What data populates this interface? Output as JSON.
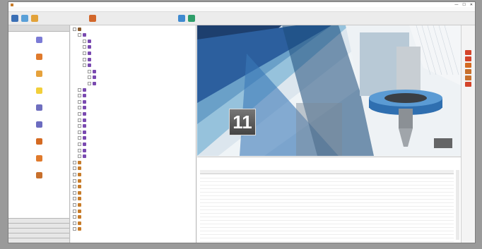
{
  "window": {
    "title": "",
    "controls": [
      "—",
      "☐",
      "✕"
    ]
  },
  "menu": [],
  "left_panel": {
    "header": "",
    "items": [
      {
        "label": "",
        "icon": "part-icon",
        "color": "#7b7bd6"
      },
      {
        "label": "",
        "icon": "machine-icon",
        "color": "#e07a2c"
      },
      {
        "label": "",
        "icon": "tool-icon",
        "color": "#e6a23c"
      },
      {
        "label": "",
        "icon": "smile-icon",
        "color": "#f2cf3a"
      },
      {
        "label": "",
        "icon": "fixture-icon",
        "color": "#6f6fbf"
      },
      {
        "label": "",
        "icon": "wrench-icon",
        "color": "#6c6cc0"
      },
      {
        "label": "",
        "icon": "gear-icon",
        "color": "#d46a22"
      },
      {
        "label": "",
        "icon": "cart-icon",
        "color": "#e07a2c"
      },
      {
        "label": "",
        "icon": "box-icon",
        "color": "#c8702c"
      }
    ],
    "bottom_buttons": [
      "",
      "",
      "",
      "",
      ""
    ]
  },
  "tree": {
    "nodes": [
      {
        "label": "",
        "depth": 0,
        "color": "#8a5a2c"
      },
      {
        "label": "",
        "depth": 1,
        "color": "#7a4ab0"
      },
      {
        "label": "",
        "depth": 2,
        "color": "#7a4ab0"
      },
      {
        "label": "",
        "depth": 2,
        "color": "#7a4ab0"
      },
      {
        "label": "",
        "depth": 2,
        "color": "#7a4ab0"
      },
      {
        "label": "",
        "depth": 2,
        "color": "#7a4ab0"
      },
      {
        "label": "",
        "depth": 2,
        "color": "#7a4ab0"
      },
      {
        "label": "",
        "depth": 3,
        "color": "#7a4ab0"
      },
      {
        "label": "",
        "depth": 3,
        "color": "#7a4ab0"
      },
      {
        "label": "",
        "depth": 3,
        "color": "#7a4ab0"
      },
      {
        "label": "",
        "depth": 1,
        "color": "#7a4ab0"
      },
      {
        "label": "",
        "depth": 1,
        "color": "#7a4ab0"
      },
      {
        "label": "",
        "depth": 1,
        "color": "#7a4ab0"
      },
      {
        "label": "",
        "depth": 1,
        "color": "#7a4ab0"
      },
      {
        "label": "",
        "depth": 1,
        "color": "#7a4ab0"
      },
      {
        "label": "",
        "depth": 1,
        "color": "#7a4ab0"
      },
      {
        "label": "",
        "depth": 1,
        "color": "#7a4ab0"
      },
      {
        "label": "",
        "depth": 1,
        "color": "#7a4ab0"
      },
      {
        "label": "",
        "depth": 1,
        "color": "#7a4ab0"
      },
      {
        "label": "",
        "depth": 1,
        "color": "#7a4ab0"
      },
      {
        "label": "",
        "depth": 1,
        "color": "#7a4ab0"
      },
      {
        "label": "",
        "depth": 1,
        "color": "#7a4ab0"
      },
      {
        "label": "",
        "depth": 0,
        "color": "#c77c2a"
      },
      {
        "label": "",
        "depth": 0,
        "color": "#c77c2a"
      },
      {
        "label": "",
        "depth": 0,
        "color": "#c77c2a"
      },
      {
        "label": "",
        "depth": 0,
        "color": "#c77c2a"
      },
      {
        "label": "",
        "depth": 0,
        "color": "#c77c2a"
      },
      {
        "label": "",
        "depth": 0,
        "color": "#c77c2a"
      },
      {
        "label": "",
        "depth": 0,
        "color": "#c77c2a"
      },
      {
        "label": "",
        "depth": 0,
        "color": "#c77c2a"
      },
      {
        "label": "",
        "depth": 0,
        "color": "#c77c2a"
      },
      {
        "label": "",
        "depth": 0,
        "color": "#c77c2a"
      },
      {
        "label": "",
        "depth": 0,
        "color": "#c77c2a"
      },
      {
        "label": "",
        "depth": 0,
        "color": "#c77c2a"
      }
    ]
  },
  "splash": {
    "version": "11",
    "corner_label": ""
  },
  "properties": {
    "lines": [
      "",
      "",
      ""
    ],
    "grid_columns": [
      "",
      "",
      "",
      "",
      "",
      "",
      "",
      ""
    ],
    "rows": [
      [
        "",
        "",
        "",
        "",
        "",
        "",
        "",
        ""
      ],
      [
        "",
        "",
        "",
        "",
        "",
        "",
        "",
        ""
      ],
      [
        "",
        "",
        "",
        "",
        "",
        "",
        "",
        ""
      ],
      [
        "",
        "",
        "",
        "",
        "",
        "",
        "",
        ""
      ],
      [
        "",
        "",
        "",
        "",
        "",
        "",
        "",
        ""
      ],
      [
        "",
        "",
        "",
        "",
        "",
        "",
        "",
        ""
      ],
      [
        "",
        "",
        "",
        "",
        "",
        "",
        "",
        ""
      ],
      [
        "",
        "",
        "",
        "",
        "",
        "",
        "",
        ""
      ],
      [
        "",
        "",
        "",
        "",
        "",
        "",
        "",
        ""
      ],
      [
        "",
        "",
        "",
        "",
        "",
        "",
        "",
        ""
      ],
      [
        "",
        "",
        "",
        "",
        "",
        "",
        "",
        ""
      ],
      [
        "",
        "",
        "",
        "",
        "",
        "",
        "",
        ""
      ],
      [
        "",
        "",
        "",
        "",
        "",
        "",
        "",
        ""
      ],
      [
        "",
        "",
        "",
        "",
        "",
        "",
        "",
        ""
      ],
      [
        "",
        "",
        "",
        "",
        "",
        "",
        "",
        ""
      ],
      [
        "",
        "",
        "",
        "",
        "",
        "",
        "",
        ""
      ],
      [
        "",
        "",
        "",
        "",
        "",
        "",
        "",
        ""
      ],
      [
        "",
        "",
        "",
        "",
        "",
        "",
        "",
        ""
      ],
      [
        "",
        "",
        "",
        "",
        "",
        "",
        "",
        ""
      ],
      [
        "",
        "",
        "",
        "",
        "",
        "",
        "",
        ""
      ],
      [
        "",
        "",
        "",
        "",
        "",
        "",
        "",
        ""
      ],
      [
        "",
        "",
        "",
        "",
        "",
        "",
        "",
        ""
      ]
    ]
  },
  "right_strip": [
    {
      "icon": "run-icon",
      "color": "#d4442a"
    },
    {
      "icon": "stop-icon",
      "color": "#d4442a"
    },
    {
      "icon": "report-icon",
      "color": "#d46a22"
    },
    {
      "icon": "export-icon",
      "color": "#c8702c"
    },
    {
      "icon": "print-icon",
      "color": "#c8702c"
    },
    {
      "icon": "settings-icon",
      "color": "#d4442a"
    }
  ],
  "colors": {
    "accent_blue": "#2c5f9e",
    "splash_dark": "#1d3f6e",
    "splash_cyan": "#7fb6d6"
  }
}
